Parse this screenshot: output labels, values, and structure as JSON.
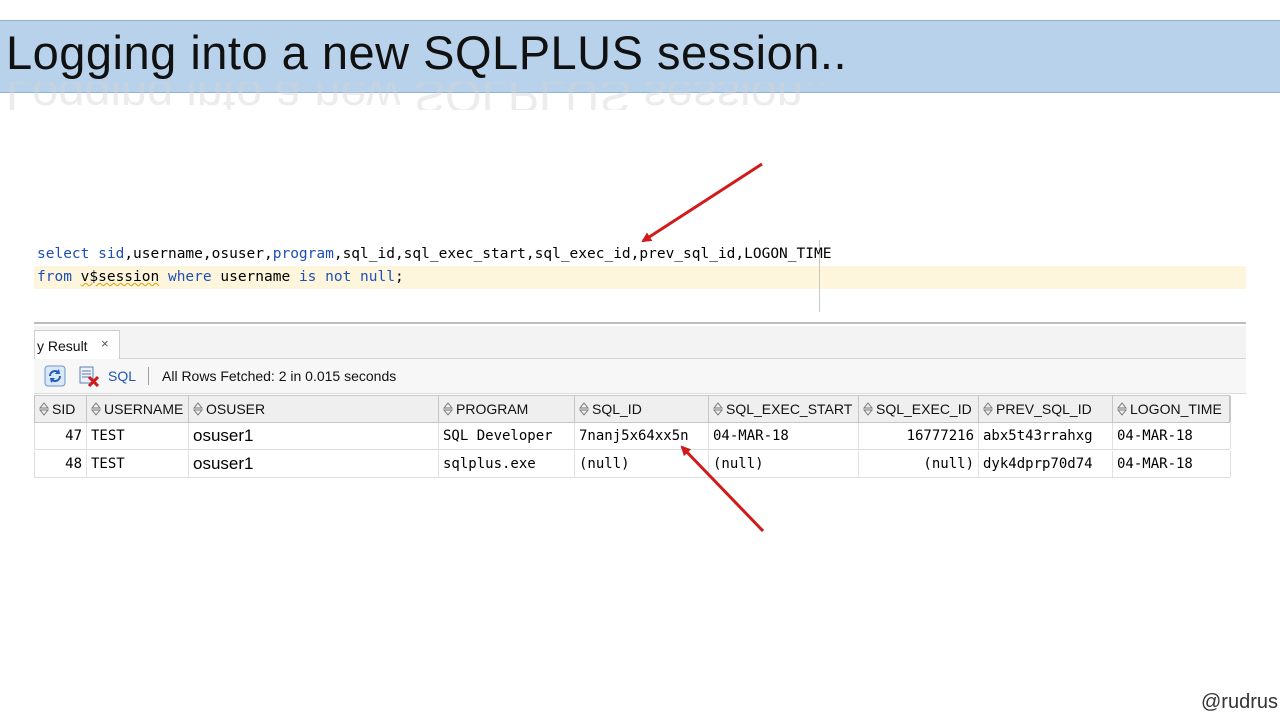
{
  "slide": {
    "title": "Logging into a new SQLPLUS session..",
    "handle": "@rudrus"
  },
  "editor": {
    "line1": [
      {
        "text": "select",
        "cls": "kw"
      },
      {
        "text": " ",
        "cls": ""
      },
      {
        "text": "sid",
        "cls": "kw"
      },
      {
        "text": ",username,osuser,",
        "cls": ""
      },
      {
        "text": "program",
        "cls": "kw"
      },
      {
        "text": ",sql_id,sql_exec_start,sql_exec_id,prev_sql_id,LOGON_TIME",
        "cls": ""
      }
    ],
    "line2": [
      {
        "text": "from",
        "cls": "kw"
      },
      {
        "text": " ",
        "cls": ""
      },
      {
        "text": "v$session",
        "cls": "squiggle"
      },
      {
        "text": " ",
        "cls": ""
      },
      {
        "text": "where",
        "cls": "kw"
      },
      {
        "text": " username ",
        "cls": ""
      },
      {
        "text": "is not null",
        "cls": "kw"
      },
      {
        "text": ";",
        "cls": ""
      }
    ]
  },
  "results": {
    "tab_label": "y Result",
    "tab_close": "×",
    "toolbar": {
      "sql_label": "SQL",
      "status": "All Rows Fetched: 2 in 0.015 seconds"
    },
    "columns": [
      "SID",
      "USERNAME",
      "OSUSER",
      "PROGRAM",
      "SQL_ID",
      "SQL_EXEC_START",
      "SQL_EXEC_ID",
      "PREV_SQL_ID",
      "LOGON_TIME"
    ],
    "rows": [
      [
        "47",
        "TEST",
        "osuser1",
        "SQL Developer",
        "7nanj5x64xx5n",
        "04-MAR-18",
        "16777216",
        "abx5t43rrahxg",
        "04-MAR-18"
      ],
      [
        "48",
        "TEST",
        "osuser1",
        "sqlplus.exe",
        "(null)",
        "(null)",
        "(null)",
        "dyk4dprp70d74",
        "04-MAR-18"
      ]
    ]
  },
  "colors": {
    "title_bar": "#b7d2ea",
    "keyword": "#1e4fb5",
    "arrow": "#d11a1a",
    "line_highlight": "#fdf6dd"
  }
}
